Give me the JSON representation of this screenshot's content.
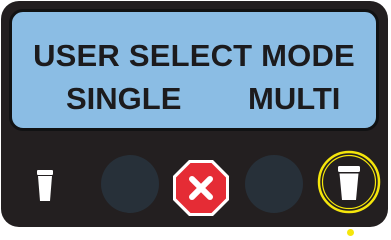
{
  "display": {
    "title": "USER SELECT MODE",
    "option_left": "SINGLE",
    "option_right": "MULTI"
  },
  "buttons": [
    {
      "id": "single-cup",
      "icon": "cup-icon"
    },
    {
      "id": "blank-left",
      "icon": "none"
    },
    {
      "id": "stop",
      "icon": "x-icon"
    },
    {
      "id": "blank-right",
      "icon": "none"
    },
    {
      "id": "multi-cup",
      "icon": "cup-icon",
      "selected": true
    }
  ],
  "colors": {
    "device": "#231f20",
    "screen": "#8bbde4",
    "stop": "#e52c35",
    "button": "#273039",
    "highlight": "#f5e60b"
  }
}
